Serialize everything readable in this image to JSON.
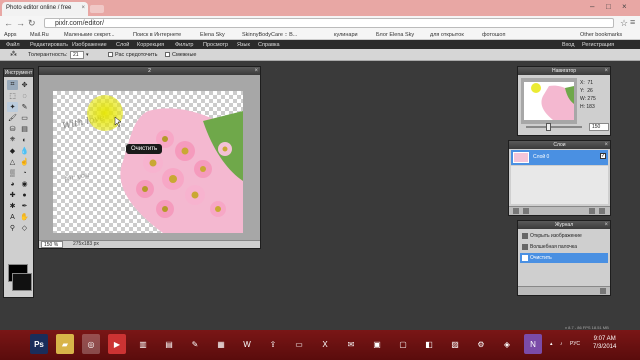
{
  "browser": {
    "tab_title": "Photo editor online / free",
    "url": "pixlr.com/editor/",
    "bookmarks": [
      "Apps",
      "Mail.Ru",
      "Маленькие секрет...",
      "Поиск в Интернете",
      "Elena Sky",
      "SkinnyBodyCare :: B...",
      "кулинари",
      "Блог Elena Sky",
      "для открыток",
      "фотошоп"
    ],
    "other_bookmarks": "Other bookmarks"
  },
  "menubar": {
    "items": [
      "Файл",
      "Редактировать",
      "Изображение",
      "Слой",
      "Коррекция",
      "Фильтр",
      "Просмотр",
      "Язык",
      "Справка"
    ],
    "login": "Вход",
    "register": "Регистрация"
  },
  "options": {
    "tolerance_label": "Толерантность:",
    "tolerance_value": "21",
    "antialias_label": "Рас средоточить",
    "contiguous_label": "Смежные"
  },
  "tools_panel": {
    "title": "Инструмент"
  },
  "document": {
    "title": "2",
    "zoom": "150 %",
    "dims": "275x183 px",
    "tooltip": "Очистить"
  },
  "navigator": {
    "title": "Навигатор",
    "info": "X:  71\nY:  26\nW: 275\nH: 183",
    "zoom": "150"
  },
  "layers": {
    "title": "Слои",
    "layer_name": "Слой 0"
  },
  "history": {
    "title": "Журнал",
    "items": [
      "Открыть изображение",
      "Волшебная палочка",
      "Очистить"
    ]
  },
  "footer_text": "v 8.7 - 86 FPS 18.51 MB",
  "taskbar": {
    "lang": "РУС",
    "time": "9:07 AM",
    "date": "7/3/2014"
  },
  "colors": {
    "selection_blue": "#4a90e2",
    "taskbar_red": "#6e1212",
    "chrome_title_pink": "#e8a7a4"
  }
}
